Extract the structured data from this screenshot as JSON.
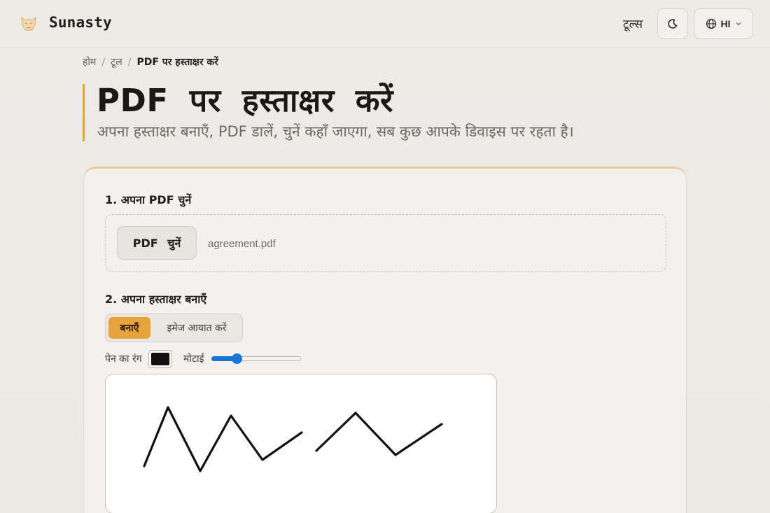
{
  "header": {
    "brand": "Sunasty",
    "nav_tools": "टूल्स",
    "lang": "HI",
    "icons": {
      "logo": "fox-logo",
      "theme": "moon-icon",
      "lang": "globe-icon",
      "chevron": "chevron-down-icon"
    }
  },
  "breadcrumb": {
    "home": "होम",
    "tools": "टूल",
    "current": "PDF पर हस्ताक्षर करें",
    "separator": "/"
  },
  "page": {
    "title": "PDF पर हस्ताक्षर करें",
    "subtitle": "अपना हस्ताक्षर बनाएँ, PDF डालें, चुनें कहाँ जाएगा, सब कुछ आपके डिवाइस पर रहता है।",
    "accent_color": "#e8a23c"
  },
  "step1": {
    "label": "1. अपना PDF चुनें",
    "button": "PDF चुनें",
    "file_name": "agreement.pdf"
  },
  "step2": {
    "label": "2. अपना हस्ताक्षर बनाएँ",
    "tabs": [
      {
        "label": "बनाएँ",
        "active": true
      },
      {
        "label": "इमेज आयात करें",
        "active": false
      }
    ],
    "pen_color_label": "पेन का रंग",
    "pen_color": "#111111",
    "thickness_label": "मोटाई",
    "thickness_fraction": 0.26,
    "slider_color": "#1a73d8"
  }
}
